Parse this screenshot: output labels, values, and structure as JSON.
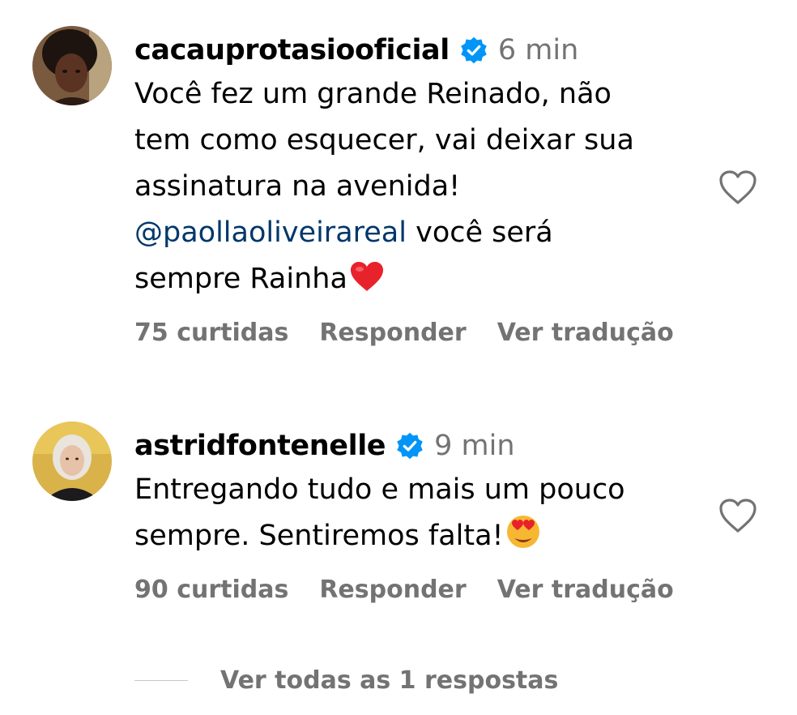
{
  "comments": [
    {
      "username": "cacauprotasiooficial",
      "time": "6 min",
      "text_lines": [
        "Você fez um grande Reinado, não",
        "tem como esquecer, vai deixar sua",
        "assinatura na avenida!"
      ],
      "mention": "@paollaoliveirareal",
      "mention_suffix": " você será",
      "last_line": "sempre Rainha",
      "emoji": "red-heart",
      "likes": "75 curtidas",
      "reply_label": "Responder",
      "translate_label": "Ver tradução"
    },
    {
      "username": "astridfontenelle",
      "time": "9 min",
      "text_lines": [
        "Entregando tudo e mais um pouco"
      ],
      "last_line": "sempre. Sentiremos falta!",
      "emoji": "heart-eyes-face",
      "likes": "90 curtidas",
      "reply_label": "Responder",
      "translate_label": "Ver tradução"
    }
  ],
  "view_replies": "Ver todas as 1 respostas",
  "colors": {
    "verified": "#0095f6",
    "mention": "#00376b",
    "secondary_text": "#737373"
  },
  "icons": [
    "verified-badge-icon",
    "heart-outline-icon",
    "red-heart-emoji",
    "heart-eyes-emoji"
  ]
}
